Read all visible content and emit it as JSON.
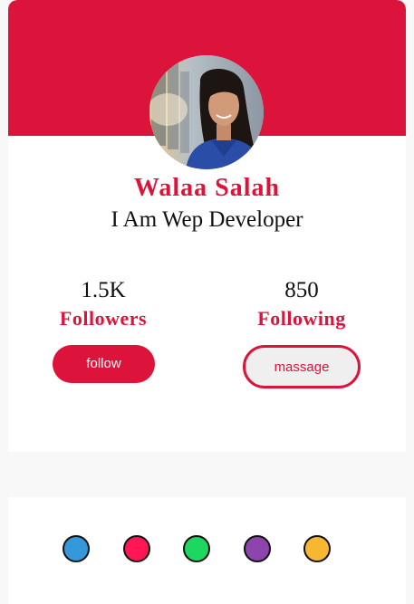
{
  "profile": {
    "name": "Walaa Salah",
    "role": "I Am Wep Developer"
  },
  "stats": {
    "followers_value": "1.5K",
    "followers_label": "Followers",
    "following_value": "850",
    "following_label": "Following"
  },
  "actions": {
    "follow_label": "follow",
    "message_label": "massage"
  },
  "theme": {
    "accent": "#dc143c",
    "swatches": [
      "#3498db",
      "#ff1654",
      "#1ed760",
      "#8e44ad",
      "#f7b731"
    ]
  }
}
